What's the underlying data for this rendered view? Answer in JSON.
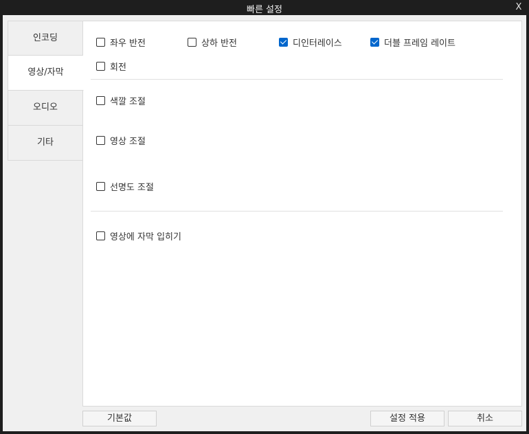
{
  "window": {
    "title": "빠른 설정",
    "close_label": "X"
  },
  "sidebar": {
    "tabs": [
      {
        "label": "인코딩",
        "active": false
      },
      {
        "label": "영상/자막",
        "active": true
      },
      {
        "label": "오디오",
        "active": false
      },
      {
        "label": "기타",
        "active": false
      }
    ]
  },
  "options": {
    "flip_horizontal": {
      "label": "좌우 반전",
      "checked": false
    },
    "flip_vertical": {
      "label": "상하 반전",
      "checked": false
    },
    "deinterlace": {
      "label": "디인터레이스",
      "checked": true
    },
    "double_frame_rate": {
      "label": "더블 프레임 레이트",
      "checked": true
    },
    "rotate": {
      "label": "회전",
      "checked": false
    },
    "color_adjust": {
      "label": "색깔 조절",
      "checked": false
    },
    "video_adjust": {
      "label": "영상 조절",
      "checked": false
    },
    "sharpness_adjust": {
      "label": "선명도 조절",
      "checked": false
    },
    "burn_subtitles": {
      "label": "영상에 자막 입히기",
      "checked": false
    }
  },
  "footer": {
    "default_label": "기본값",
    "apply_label": "설정 적용",
    "cancel_label": "취소"
  },
  "colors": {
    "accent": "#0066cc",
    "titlebar": "#1e1e1e",
    "client_bg": "#f0f0f0"
  }
}
